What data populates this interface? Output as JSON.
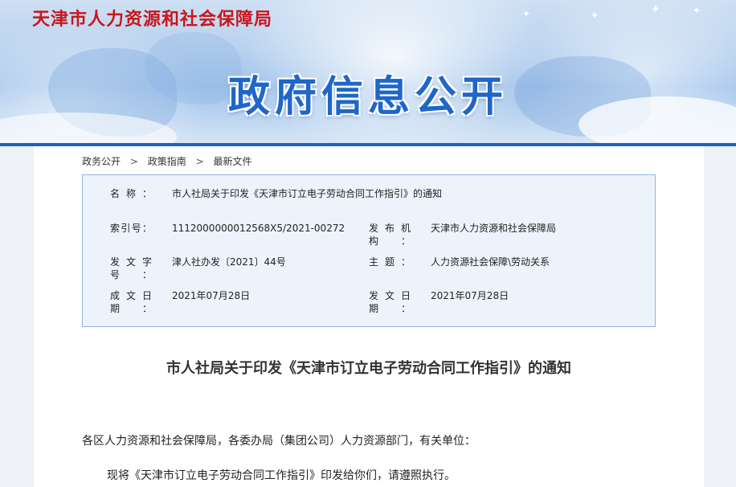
{
  "header": {
    "site_name": "天津市人力资源和社会保障局",
    "banner_title": "政府信息公开"
  },
  "breadcrumb": {
    "items": [
      "政务公开",
      "政策指南",
      "最新文件"
    ],
    "separator": ">"
  },
  "meta": {
    "name_label": "名称：",
    "name_value": "市人社局关于印发《天津市订立电子劳动合同工作指引》的通知",
    "index_label": "索引号：",
    "index_value": "1112000000012568X5/2021-00272",
    "publisher_label": "发布机构：",
    "publisher_value": "天津市人力资源和社会保障局",
    "docno_label": "发文字号：",
    "docno_value": "津人社办发〔2021〕44号",
    "subject_label": "主题：",
    "subject_value": "人力资源社会保障\\劳动关系",
    "created_label": "成文日期：",
    "created_value": "2021年07月28日",
    "issued_label": "发文日期：",
    "issued_value": "2021年07月28日"
  },
  "document": {
    "title": "市人社局关于印发《天津市订立电子劳动合同工作指引》的通知",
    "salutation": "各区人力资源和社会保障局，各委办局（集团公司）人力资源部门，有关单位：",
    "body_1": "现将《天津市订立电子劳动合同工作指引》印发给你们，请遵照执行。"
  },
  "colors": {
    "brand_red": "#c8161d",
    "banner_blue": "#1f66c9",
    "rule_blue": "#1e64b8",
    "meta_bg": "#edf3fb",
    "meta_border": "#8fb5e3"
  }
}
